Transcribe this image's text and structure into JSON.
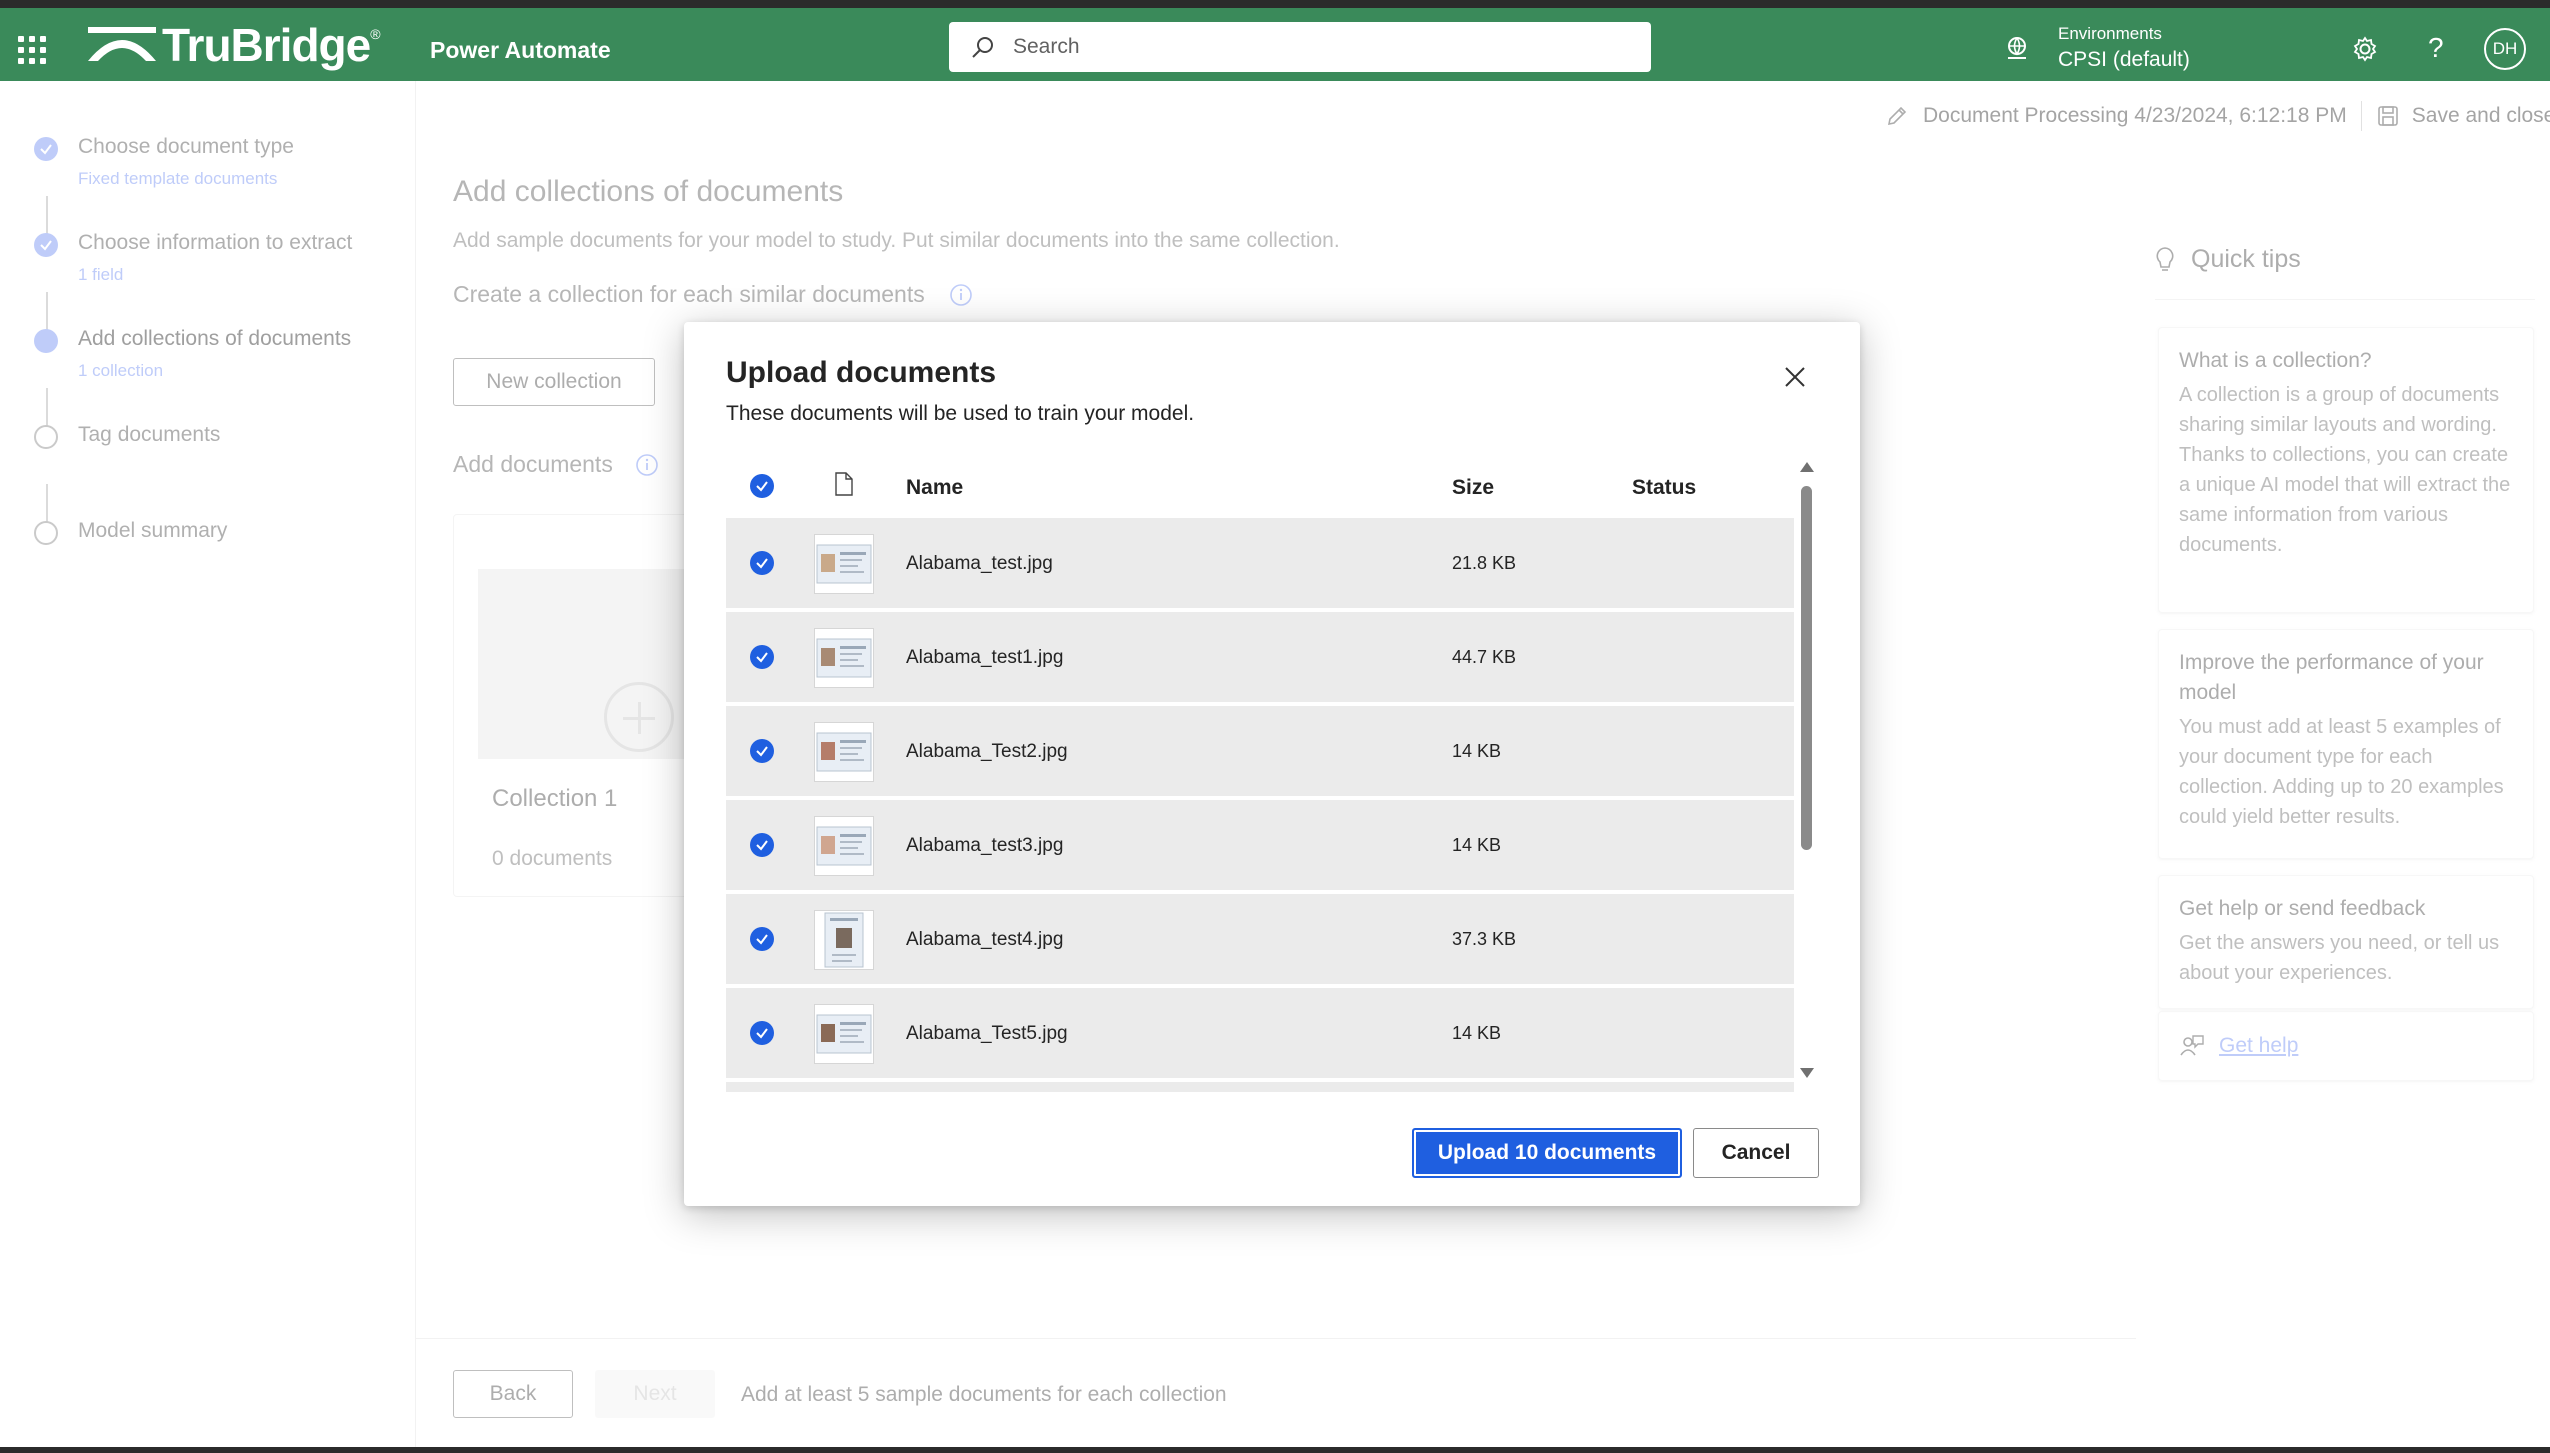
{
  "header": {
    "brand": "TruBridge",
    "brand_tm": "®",
    "app_name": "Power Automate",
    "search_placeholder": "Search",
    "env_label": "Environments",
    "env_value": "CPSI (default)",
    "user_initials": "DH",
    "icons": [
      "waffle-icon",
      "search-icon",
      "environment-icon",
      "gear-icon",
      "help-icon"
    ]
  },
  "steps": [
    {
      "title": "Choose document type",
      "sub": "Fixed template documents",
      "state": "done"
    },
    {
      "title": "Choose information to extract",
      "sub": "1 field",
      "state": "done"
    },
    {
      "title": "Add collections of documents",
      "sub": "1 collection",
      "state": "current"
    },
    {
      "title": "Tag documents",
      "sub": "",
      "state": "todo"
    },
    {
      "title": "Model summary",
      "sub": "",
      "state": "todo"
    }
  ],
  "topinfo": {
    "doc_name": "Document Processing 4/23/2024, 6:12:18 PM",
    "save_close": "Save and close"
  },
  "main": {
    "title": "Add collections of documents",
    "subtitle": "Add sample documents for your model to study. Put similar documents into the same collection.",
    "create_heading": "Create a collection for each similar documents",
    "new_collection": "New collection",
    "add_documents": "Add documents",
    "collection": {
      "name": "Collection 1",
      "count": "0 documents"
    }
  },
  "footer": {
    "back": "Back",
    "next": "Next",
    "hint": "Add at least 5 sample documents for each collection"
  },
  "tips": {
    "title": "Quick tips",
    "cards": [
      {
        "heading": "What is a collection?",
        "body": "A collection is a group of documents sharing similar layouts and wording. Thanks to collections, you can create a unique AI model that will extract the same information from various documents."
      },
      {
        "heading": "Improve the performance of your model",
        "body": "You must add at least 5 examples of your document type for each collection. Adding up to 20 examples could yield better results."
      },
      {
        "heading": "Get help or send feedback",
        "body": "Get the answers you need, or tell us about your experiences."
      }
    ],
    "get_help": "Get help"
  },
  "dialog": {
    "title": "Upload documents",
    "subtitle": "These documents will be used to train your model.",
    "columns": {
      "name": "Name",
      "size": "Size",
      "status": "Status"
    },
    "rows": [
      {
        "name": "Alabama_test.jpg",
        "size": "21.8 KB",
        "status": ""
      },
      {
        "name": "Alabama_test1.jpg",
        "size": "44.7 KB",
        "status": ""
      },
      {
        "name": "Alabama_Test2.jpg",
        "size": "14 KB",
        "status": ""
      },
      {
        "name": "Alabama_test3.jpg",
        "size": "14 KB",
        "status": ""
      },
      {
        "name": "Alabama_test4.jpg",
        "size": "37.3 KB",
        "status": ""
      },
      {
        "name": "Alabama_Test5.jpg",
        "size": "14 KB",
        "status": ""
      }
    ],
    "upload_button": "Upload 10 documents",
    "cancel_button": "Cancel"
  },
  "colors": {
    "header_green": "#3a8a5a",
    "primary_blue": "#1f5fe0",
    "step_blue": "#8aa3f5"
  }
}
